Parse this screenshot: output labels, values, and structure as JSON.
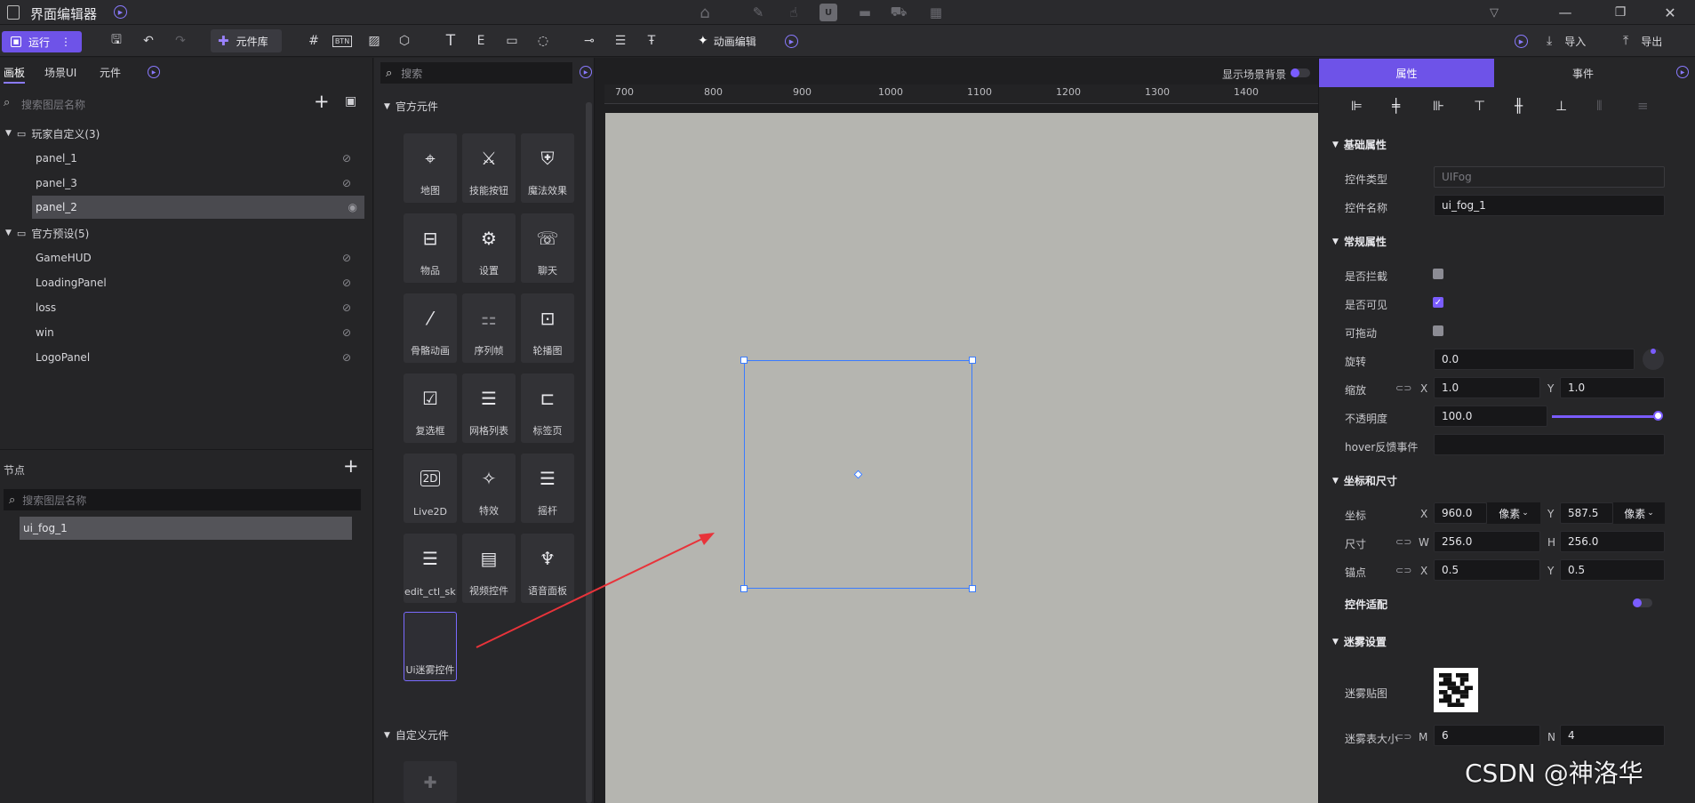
{
  "titlebar": {
    "title": "界面编辑器"
  },
  "toolbar": {
    "run_label": "运行",
    "library_label": "元件库",
    "anim_label": "动画编辑",
    "import_label": "导入",
    "export_label": "导出"
  },
  "left": {
    "tabs": [
      "画板",
      "场景UI",
      "元件"
    ],
    "search_placeholder": "搜索图层名称",
    "groups": [
      {
        "label": "玩家自定义(3)",
        "items": [
          "panel_1",
          "panel_3",
          "panel_2"
        ]
      },
      {
        "label": "官方预设(5)",
        "items": [
          "GameHUD",
          "LoadingPanel",
          "loss",
          "win",
          "LogoPanel"
        ]
      }
    ],
    "nodes_title": "节点",
    "nodes_search_placeholder": "搜索图层名称",
    "nodes": [
      "ui_fog_1"
    ]
  },
  "library": {
    "search_placeholder": "搜索",
    "official_title": "官方元件",
    "items": [
      "地图",
      "技能按钮",
      "魔法效果",
      "物品",
      "设置",
      "聊天",
      "骨骼动画",
      "序列帧",
      "轮播图",
      "复选框",
      "网格列表",
      "标签页",
      "Live2D",
      "特效",
      "摇杆",
      "edit_ctl_ski",
      "视频控件",
      "语音面板",
      "Ui迷雾控件"
    ],
    "custom_title": "自定义元件"
  },
  "canvas": {
    "show_bg_label": "显示场景背景",
    "ruler": [
      "700",
      "800",
      "900",
      "1000",
      "1100",
      "1200",
      "1300",
      "1400"
    ]
  },
  "right": {
    "tabs": [
      "属性",
      "事件"
    ],
    "basic_title": "基础属性",
    "type_label": "控件类型",
    "type_value": "UIFog",
    "name_label": "控件名称",
    "name_value": "ui_fog_1",
    "common_title": "常规属性",
    "intercept_label": "是否拦截",
    "visible_label": "是否可见",
    "drag_label": "可拖动",
    "rotate_label": "旋转",
    "rotate_value": "0.0",
    "scale_label": "缩放",
    "scale_x": "1.0",
    "scale_y": "1.0",
    "opacity_label": "不透明度",
    "opacity_value": "100.0",
    "opacity": 1.0,
    "hover_label": "hover反馈事件",
    "coord_title": "坐标和尺寸",
    "pos_label": "坐标",
    "pos_x": "960.0",
    "pos_y": "587.5",
    "unit": "像素",
    "size_label": "尺寸",
    "size_w": "256.0",
    "size_h": "256.0",
    "anchor_label": "锚点",
    "anchor_x": "0.5",
    "anchor_y": "0.5",
    "fit_label": "控件适配",
    "fog_title": "迷雾设置",
    "fog_tex_label": "迷雾贴图",
    "fog_size_label": "迷雾表大小",
    "fog_m": "6",
    "fog_n": "4",
    "x": "X",
    "y": "Y",
    "w": "W",
    "h": "H",
    "m": "M",
    "n": "N"
  },
  "watermark": "CSDN @神洛华"
}
